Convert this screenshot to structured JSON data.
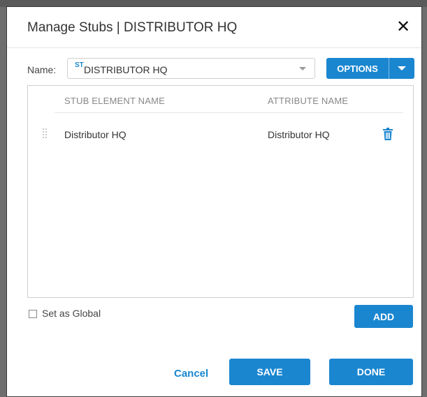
{
  "dialog": {
    "title": "Manage Stubs | DISTRIBUTOR HQ",
    "close_icon": "close-icon"
  },
  "name_field": {
    "label": "Name:",
    "prefix": "ST",
    "value": "DISTRIBUTOR HQ"
  },
  "options_button": {
    "label": "OPTIONS"
  },
  "table": {
    "columns": [
      "STUB ELEMENT NAME",
      "ATTRIBUTE NAME"
    ],
    "rows": [
      {
        "stub_element_name": "Distributor HQ",
        "attribute_name": "Distributor HQ"
      }
    ]
  },
  "global_checkbox": {
    "label": "Set as Global",
    "checked": false
  },
  "buttons": {
    "add": "ADD",
    "cancel": "Cancel",
    "save": "SAVE",
    "done": "DONE"
  },
  "colors": {
    "accent": "#1a86d0"
  }
}
